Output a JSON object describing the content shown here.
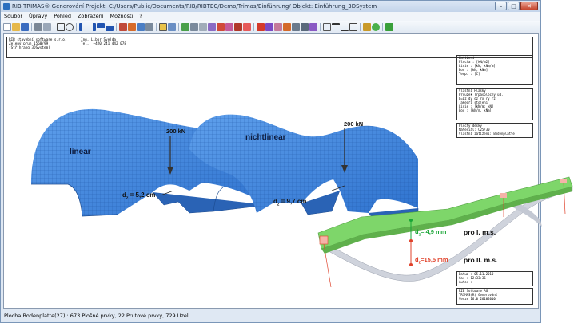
{
  "window": {
    "title": "RIB TRIMAS®  Generování  Projekt: C:/Users/Public/Documents/RIB/RIBTEC/Demo/Trimas/Einführung/  Objekt: Einführung_3DSystem",
    "minimize": "–",
    "maximize": "□",
    "close": "✕"
  },
  "menu": [
    "Soubor",
    "Úpravy",
    "Pohled",
    "Zobrazení",
    "Možnosti",
    "?"
  ],
  "header": {
    "left_lines": [
      "RIB stavební software s.r.o.",
      "Zelený pruh 1560/99",
      "(Stř hranq_3DSystem)"
    ],
    "right_lines": [
      "Ing. Libor Švejda",
      "Tel.: +420 241 442 078"
    ]
  },
  "panel_units": [
    "Zatížení",
    "Plocha   : [kN/m2]",
    "Linie    : [kN, kNm/m]",
    "Bod      : [kN, kNm]",
    "Temp.    : [C]"
  ],
  "panel_loads": [
    "Vlastní   Hlasky",
    "Proužek  Trpasplochý úd.",
    "b=Dz  dy  dz  rx  ry  rz",
    "Takeoři  stojení",
    "Linie    : [kN/m; kN]",
    "Bod      : [kN/m, kNm]"
  ],
  "panel_plate": [
    "Plochy desky",
    "Materiál: C25/30",
    "Vlastní zatížení: Bodenplatte"
  ],
  "panel_date": [
    "Datum  :  05.11.2010",
    "Čas    :  12:33:36",
    "Autor  :"
  ],
  "panel_company": [
    "RIB Software AG",
    "TRIMAS(R) Generování",
    "Verze 16.0 26102010"
  ],
  "labels": {
    "linear": "linear",
    "nonlinear": "nichtlinear",
    "force1": "200 kN",
    "force2": "200 kN",
    "dz1": "d",
    "dz1_sub": "z",
    "dz1_val": " = 5,2 cm",
    "dz2": "d",
    "dz2_sub": "z",
    "dz2_val": " = 9,7 cm",
    "beam_dz1": "d",
    "beam_dz1_sub": "z",
    "beam_dz1_val": "= 4,9 mm",
    "beam_ms1": "pro I. m.s.",
    "beam_dz2": "d",
    "beam_dz2_sub": "z",
    "beam_dz2_val": "=15,5 mm",
    "beam_ms2": "pro II. m.s."
  },
  "status": "Plocha Bodenplatte(27) : 673 Plošné prvky, 22 Prutové prvky, 729 Uzel",
  "colors": {
    "shell": "#3b86e0",
    "shell_dark": "#2a63b5",
    "beam_green": "#7ed66a",
    "beam_grey": "#cfd3dc",
    "dim_red": "#e0412a",
    "dim_green": "#1aa637"
  }
}
